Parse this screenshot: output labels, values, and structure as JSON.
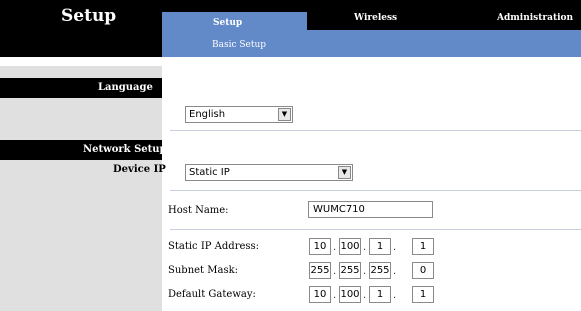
{
  "header": {
    "title": "Setup",
    "tabs": [
      {
        "label": "Setup",
        "sub": "Basic Setup",
        "active": true
      },
      {
        "label": "Wireless",
        "active": false
      },
      {
        "label": "Administration",
        "active": false
      }
    ]
  },
  "sidebar": {
    "language_section": "Language",
    "network_section": "Network Setup",
    "device_ip_label": "Device IP"
  },
  "language": {
    "selected": "English"
  },
  "network": {
    "mode_selected": "Static IP",
    "host_name_label": "Host Name:",
    "host_name_value": "WUMC710",
    "static_ip_label": "Static IP Address:",
    "static_ip": [
      "10",
      "100",
      "1",
      "1"
    ],
    "subnet_label": "Subnet Mask:",
    "subnet": [
      "255",
      "255",
      "255",
      "0"
    ],
    "gateway_label": "Default Gateway:",
    "gateway": [
      "10",
      "100",
      "1",
      "1"
    ]
  },
  "colors": {
    "black": "#000000",
    "tab_blue": "#6289c8",
    "sidebar_grey": "#e0e0e0"
  }
}
